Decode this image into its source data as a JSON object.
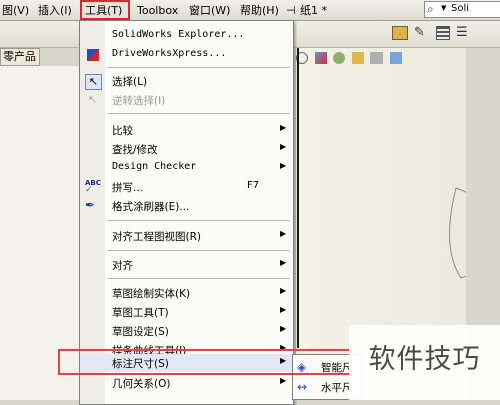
{
  "menubar": {
    "view": "图(V)",
    "insert": "插入(I)",
    "tools": "工具(T)",
    "toolbox": "Toolbox",
    "window": "窗口(W)",
    "help": "帮助(H)",
    "doc_title": "纸1 *",
    "search_value": "Soli"
  },
  "tree_tab": "零产品",
  "colors": {
    "highlight": "#d9464a",
    "menu_bg": "#fbfbf8"
  },
  "tools_menu": {
    "solidworks_explorer": "SolidWorks Explorer...",
    "driveworks": "DriveWorksXpress...",
    "select": "选择(L)",
    "reverse_select": "逆转选择(I)",
    "compare": "比较",
    "find_modify": "查找/修改",
    "design_checker": "Design Checker",
    "spelling": "拼写...",
    "spelling_shortcut": "F7",
    "format_painter": "格式涂刷器(E)...",
    "align_drawing_views": "对齐工程图视图(R)",
    "align": "对齐",
    "sketch_entities": "草图绘制实体(K)",
    "sketch_tools": "草图工具(T)",
    "sketch_settings": "草图设定(S)",
    "spline_tools": "样条曲线工具(I)",
    "dimensions": "标注尺寸(S)",
    "relations": "几何关系(O)"
  },
  "submenu": {
    "smart": "智能尺",
    "horizontal": "水平尺"
  },
  "watermark": "软件技巧"
}
